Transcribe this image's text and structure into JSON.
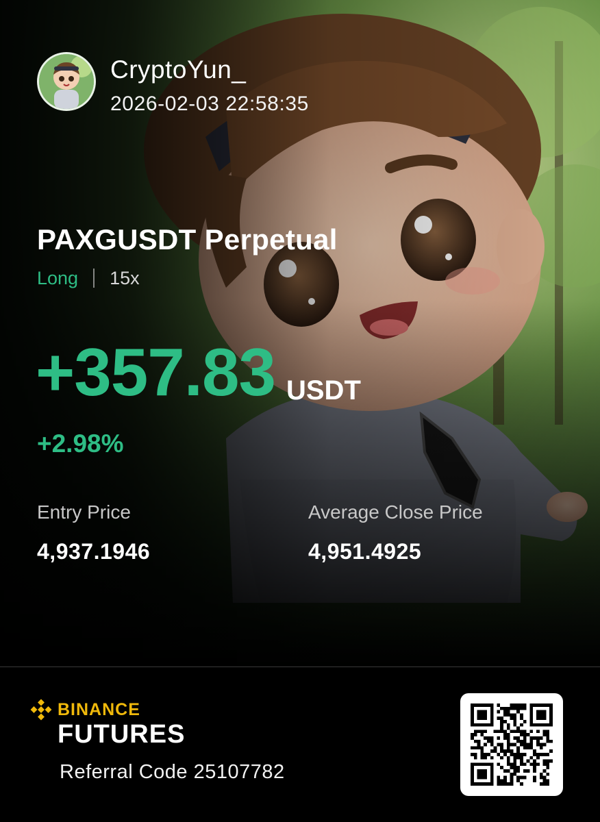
{
  "user": {
    "name": "CryptoYun_",
    "timestamp": "2026-02-03 22:58:35"
  },
  "position": {
    "pair": "PAXGUSDT Perpetual",
    "side": "Long",
    "leverage": "15x",
    "pnl": "+357.83",
    "pnl_unit": "USDT",
    "pnl_percent": "+2.98%",
    "entry_label": "Entry Price",
    "entry_value": "4,937.1946",
    "close_label": "Average Close Price",
    "close_value": "4,951.4925"
  },
  "footer": {
    "brand": "BINANCE",
    "product": "FUTURES",
    "referral": "Referral Code 25107782"
  },
  "colors": {
    "profit": "#2ebd85",
    "brand": "#f0b90b",
    "background": "#000000"
  },
  "icons": {
    "brand_logo": "binance-logo-icon",
    "qr": "qr-code-icon",
    "avatar": "avatar-image"
  }
}
